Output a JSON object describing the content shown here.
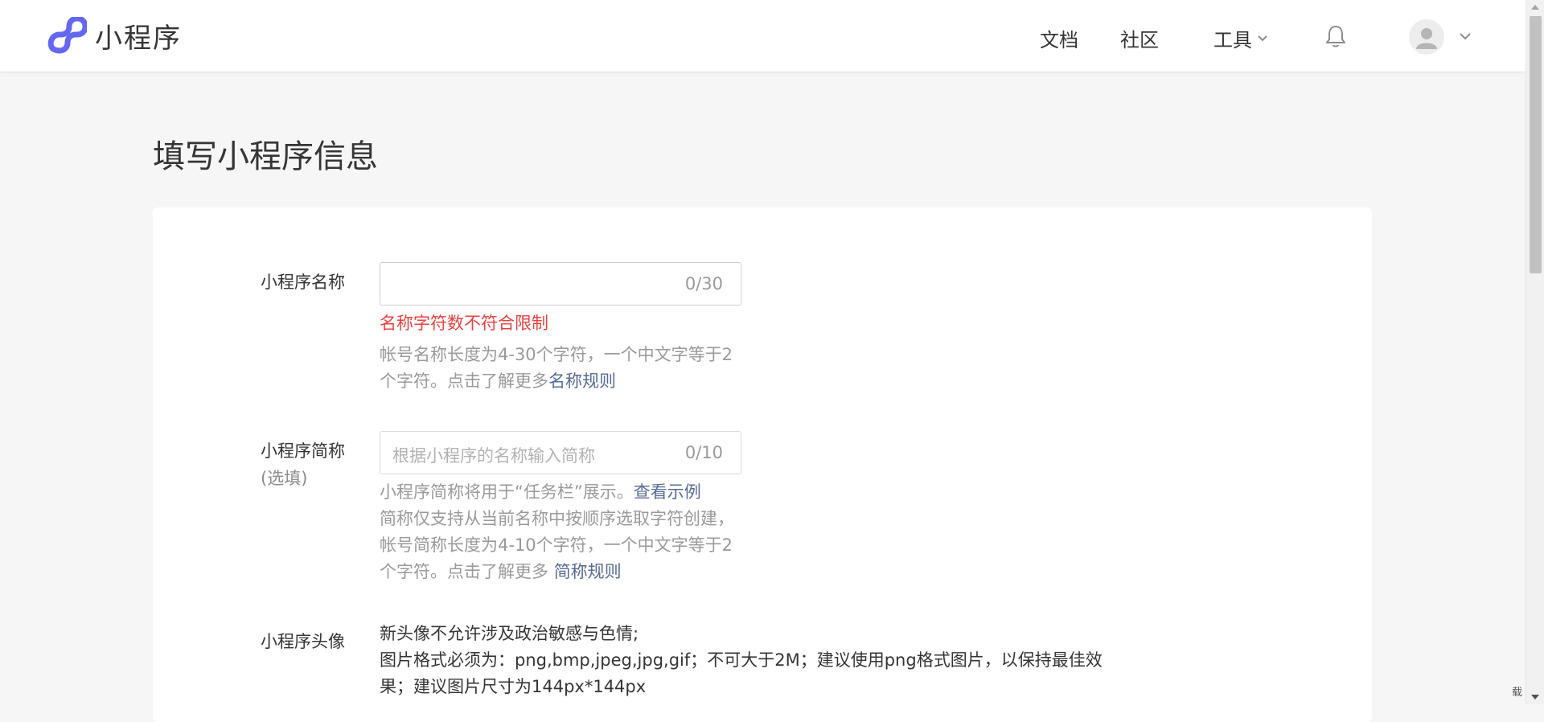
{
  "header": {
    "app_name": "小程序",
    "nav": {
      "docs": "文档",
      "community": "社区",
      "tools": "工具"
    }
  },
  "page": {
    "title": "填写小程序信息"
  },
  "form": {
    "name": {
      "label": "小程序名称",
      "value": "",
      "counter": "0/30",
      "error": "名称字符数不符合限制",
      "help_text": "帐号名称长度为4-30个字符，一个中文字等于2个字符。点击了解更多",
      "help_link": "名称规则"
    },
    "short_name": {
      "label": "小程序简称",
      "optional": "(选填)",
      "placeholder": "根据小程序的名称输入简称",
      "counter": "0/10",
      "help_text_1": "小程序简称将用于“任务栏”展示。",
      "help_link_1": "查看示例",
      "help_text_2": "简称仅支持从当前名称中按顺序选取字符创建，帐号简称长度为4-10个字符，一个中文字等于2个字符。点击了解更多 ",
      "help_link_2": "简称规则"
    },
    "avatar": {
      "label": "小程序头像",
      "line1": "新头像不允许涉及政治敏感与色情;",
      "line2": "图片格式必须为：png,bmp,jpeg,jpg,gif；不可大于2M；建议使用png格式图片，以保持最佳效果；建议图片尺寸为144px*144px"
    }
  },
  "corner": {
    "text": "载"
  },
  "colors": {
    "logo": "#6467f0",
    "error": "#e64340",
    "link": "#576b95",
    "muted": "#9a9a9a"
  }
}
